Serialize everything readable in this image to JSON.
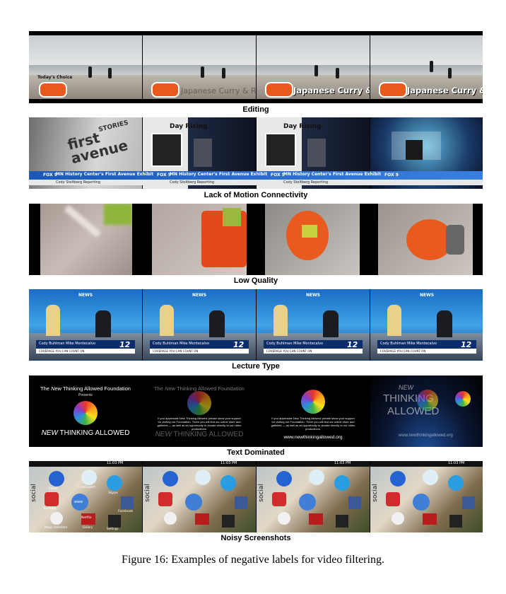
{
  "rows": [
    {
      "caption": "Editing",
      "overlay_text": "Japanese Curry & Rice",
      "logo_text": "Today's Choice"
    },
    {
      "caption": "Lack of Motion Connectivity",
      "lower_third_title": "MN History Center's First Avenue Exhibit",
      "lower_third_sub": "Cody Stoltberg Reporting",
      "station_logo": "FOX 9",
      "scene_text": "first avenue",
      "scene_text_2": "STORIES",
      "poster_text": "Day Rising"
    },
    {
      "caption": "Low Quality"
    },
    {
      "caption": "Lecture Type",
      "network": "NEWS",
      "channel_number": "12",
      "ticker_names": "Cody Buhlman   Mike Montecalvo",
      "ticker_sub": "COVERAGE YOU CAN COUNT ON"
    },
    {
      "caption": "Text Dominated",
      "slide_title_pre": "The ",
      "slide_title_em": "New",
      "slide_title_post": " Thinking Allowed Foundation",
      "presents": "Presents",
      "brand_em": "NEW",
      "brand_rest": " THINKING ALLOWED",
      "appeal": "If you appreciate New Thinking Allowed, please show your support for visiting our Foundation. There you will find our online store and galleries — as well as an opportunity to donate directly to our video productions.",
      "url": "www.newthinkingallowed.org",
      "stack_new": "NEW",
      "stack_thinking": "THINKING",
      "stack_allowed": "ALLOWED"
    },
    {
      "caption": "Noisy Screenshots",
      "status_time": "11:03 PM",
      "side_label": "social",
      "apps": [
        "Email",
        "LiveExpert",
        "Skype",
        "YouTube",
        "www",
        "Facebook",
        "Music Unlimited",
        "Netflix",
        "Gallery",
        "Settings"
      ]
    }
  ],
  "figure_caption": "Figure 16: Examples of negative labels for video filtering."
}
